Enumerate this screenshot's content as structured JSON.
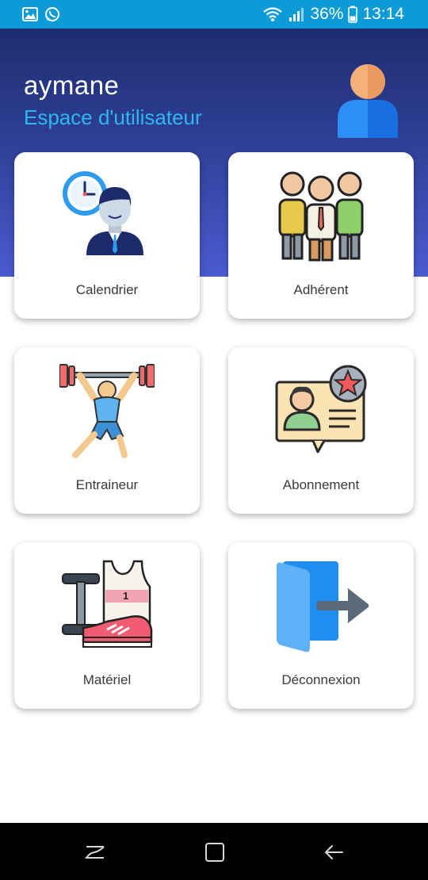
{
  "status_bar": {
    "left_icons": [
      "image-icon",
      "whatsapp-icon"
    ],
    "battery": "36%",
    "time": "13:14",
    "color": "#0b9bd6"
  },
  "header": {
    "username": "aymane",
    "subtitle": "Espace d'utilisateur",
    "avatar_icon": "user-avatar-icon",
    "gradient_top": "#1e2d6e",
    "gradient_bottom": "#4b5bd1",
    "subtitle_color": "#2fb7f0"
  },
  "menu": [
    {
      "label": "Calendrier",
      "icon": "calendar-person-icon"
    },
    {
      "label": "Adhérent",
      "icon": "members-group-icon"
    },
    {
      "label": "Entraineur",
      "icon": "weightlifter-icon"
    },
    {
      "label": "Abonnement",
      "icon": "subscription-card-icon"
    },
    {
      "label": "Matériel",
      "icon": "gym-equipment-icon"
    },
    {
      "label": "Déconnexion",
      "icon": "logout-door-icon"
    }
  ],
  "nav_bar": {
    "buttons": [
      "recents-icon",
      "home-icon",
      "back-icon"
    ]
  }
}
